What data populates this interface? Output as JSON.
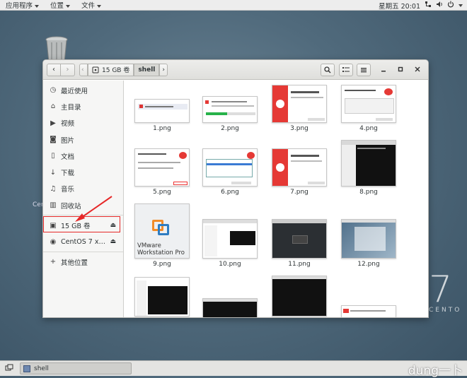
{
  "topbar": {
    "apps": "应用程序",
    "places": "位置",
    "file": "文件",
    "clock": "星期五 20:01"
  },
  "desktop": {
    "centos_partial": "Cent",
    "big7": "7",
    "centos_text": "CENTO"
  },
  "window": {
    "path": {
      "drive": "15 GB 卷",
      "folder": "shell"
    },
    "sidebar": [
      {
        "label": "最近使用",
        "icon": "clock-icon"
      },
      {
        "label": "主目录",
        "icon": "home-icon"
      },
      {
        "label": "视频",
        "icon": "video-icon"
      },
      {
        "label": "图片",
        "icon": "camera-icon"
      },
      {
        "label": "文档",
        "icon": "document-icon"
      },
      {
        "label": "下载",
        "icon": "download-icon"
      },
      {
        "label": "音乐",
        "icon": "music-icon"
      },
      {
        "label": "回收站",
        "icon": "trash-icon"
      }
    ],
    "devices": [
      {
        "label": "15 GB 卷",
        "icon": "drive-icon"
      },
      {
        "label": "CentOS 7 x…",
        "icon": "disc-icon"
      }
    ],
    "other": "其他位置",
    "files": [
      "1.png",
      "2.png",
      "3.png",
      "4.png",
      "5.png",
      "6.png",
      "7.png",
      "8.png",
      "9.png",
      "10.png",
      "11.png",
      "12.png"
    ],
    "vmware_text1": "VMware",
    "vmware_text2": "Workstation Pro"
  },
  "taskbar": {
    "task_label": "shell",
    "watermark": "dung一卜"
  }
}
